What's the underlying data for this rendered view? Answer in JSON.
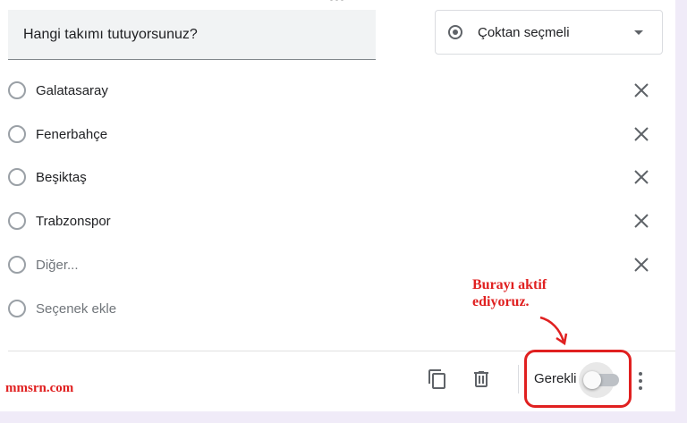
{
  "question": {
    "title": "Hangi takımı tutuyorsunuz?"
  },
  "type_select": {
    "value": "Çoktan seçmeli",
    "icon": "radio-checked-icon",
    "caret": "chevron-down-icon"
  },
  "options": [
    {
      "label": "Galatasaray"
    },
    {
      "label": "Fenerbahçe"
    },
    {
      "label": "Beşiktaş"
    },
    {
      "label": "Trabzonspor"
    },
    {
      "label": "Diğer..."
    }
  ],
  "add_option": {
    "label": "Seçenek ekle"
  },
  "footer": {
    "copy_icon": "copy-icon",
    "delete_icon": "trash-icon",
    "required_label": "Gerekli",
    "required_on": false,
    "more_icon": "more-vert-icon"
  },
  "annotation": {
    "line1": "Burayı aktif",
    "line2": "ediyoruz."
  },
  "watermark": "mmsrn.com",
  "colors": {
    "accent_red": "#e02020",
    "icon_gray": "#5f6368",
    "field_bg": "#f1f3f4"
  }
}
